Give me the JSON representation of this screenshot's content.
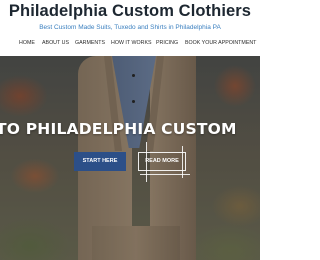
{
  "header": {
    "title": "Philadelphia Custom Clothiers",
    "tagline": "Best Custom Made Suits, Tuxedo and Shirts in Philadelphia PA"
  },
  "nav": {
    "items": [
      {
        "label": "HOME"
      },
      {
        "label": "ABOUT US"
      },
      {
        "label": "GARMENTS"
      },
      {
        "label": "HOW IT WORKS"
      },
      {
        "label": "PRICING"
      },
      {
        "label": "BOOK YOUR APPOINTMENT"
      }
    ]
  },
  "hero": {
    "headline": "TO PHILADELPHIA CUSTOM",
    "start_label": "START HERE",
    "more_label": "READ MORE"
  },
  "colors": {
    "title": "#1d2731",
    "tagline": "#3a7fbf",
    "primary_button": "#2c4f88"
  }
}
